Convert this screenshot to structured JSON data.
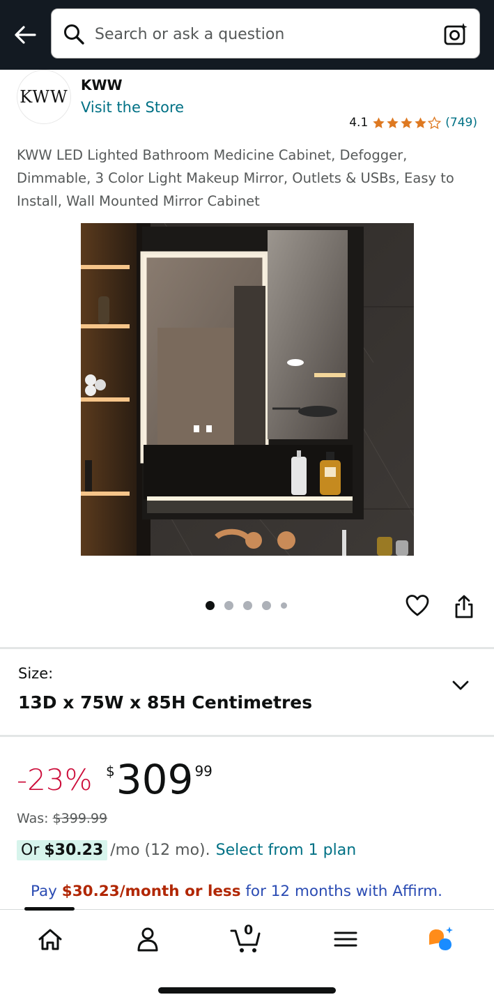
{
  "header": {
    "search_placeholder": "Search or ask a question"
  },
  "store": {
    "logo_text": "KWW",
    "brand": "KWW",
    "visit_link": "Visit the Store",
    "rating_value": "4.1",
    "rating_count": "(749)",
    "stars": 4.1
  },
  "product": {
    "title": "KWW LED Lighted Bathroom Medicine Cabinet, Defogger, Dimmable, 3 Color Light Makeup Mirror, Outlets & USBs, Easy to Install, Wall Mounted Mirror Cabinet",
    "image_count": 5,
    "active_image_index": 0
  },
  "size": {
    "label": "Size:",
    "value": "13D x 75W x 85H Centimetres"
  },
  "price": {
    "discount": "-23%",
    "currency": "$",
    "whole": "309",
    "fraction": "99",
    "was_label": "Was: ",
    "was_value": "$399.99",
    "monthly_prefix": "Or ",
    "monthly_amount": "$30.23",
    "monthly_suffix": " /mo (12 mo).",
    "plan_link": "Select from 1 plan"
  },
  "affirm": {
    "prefix": "Pay ",
    "amount": "$30.23/month or less",
    "suffix": " for 12 months with Affirm."
  },
  "bottom_nav": {
    "cart_count": "0",
    "items": [
      "home-icon",
      "account-icon",
      "cart-icon",
      "menu-icon",
      "rufus-icon"
    ]
  },
  "colors": {
    "header_bg": "#131a22",
    "link": "#007185",
    "discount": "#cc0c39",
    "star": "#de7921",
    "affirm_link": "#2a4bb3",
    "affirm_amount": "#b12704"
  }
}
